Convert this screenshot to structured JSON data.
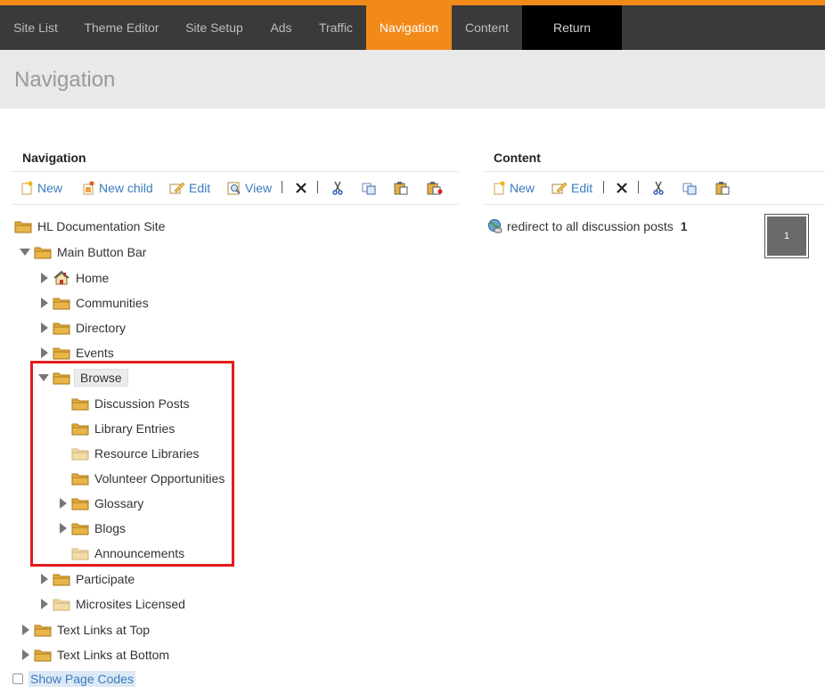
{
  "topnav": {
    "tabs": [
      {
        "label": "Site List"
      },
      {
        "label": "Theme Editor"
      },
      {
        "label": "Site Setup"
      },
      {
        "label": "Ads"
      },
      {
        "label": "Traffic"
      },
      {
        "label": "Navigation",
        "active": true
      },
      {
        "label": "Content"
      },
      {
        "label": "Return"
      }
    ],
    "accent_color": "#f28a1a"
  },
  "page": {
    "title": "Navigation"
  },
  "nav_panel": {
    "title": "Navigation",
    "toolbar": {
      "new_label": "New",
      "new_child_label": "New child",
      "edit_label": "Edit",
      "view_label": "View",
      "icons": [
        "new-icon",
        "new-child-icon",
        "edit-icon",
        "view-icon",
        "delete-icon",
        "cut-icon",
        "copy-icon",
        "paste-icon",
        "paste-child-icon"
      ]
    },
    "tree": [
      {
        "label": "HL Documentation Site",
        "icon": "folder-icon"
      },
      {
        "label": "Main Button Bar",
        "state": "expanded"
      },
      {
        "label": "Home",
        "icon": "home-icon",
        "state": "collapsed"
      },
      {
        "label": "Communities",
        "state": "collapsed"
      },
      {
        "label": "Directory",
        "state": "collapsed"
      },
      {
        "label": "Events",
        "state": "collapsed"
      },
      {
        "label": "Browse",
        "state": "expanded",
        "selected": true
      },
      {
        "label": "Discussion Posts"
      },
      {
        "label": "Library Entries"
      },
      {
        "label": "Resource Libraries",
        "faded": true
      },
      {
        "label": "Volunteer Opportunities"
      },
      {
        "label": "Glossary",
        "state": "collapsed"
      },
      {
        "label": "Blogs",
        "state": "collapsed"
      },
      {
        "label": "Announcements",
        "faded": true
      },
      {
        "label": "Participate",
        "state": "collapsed"
      },
      {
        "label": "Microsites Licensed",
        "state": "collapsed",
        "faded": true
      },
      {
        "label": "Text Links at Top",
        "state": "collapsed"
      },
      {
        "label": "Text Links at Bottom",
        "state": "collapsed"
      }
    ],
    "show_page_codes_label": "Show Page Codes"
  },
  "content_panel": {
    "title": "Content",
    "toolbar": {
      "new_label": "New",
      "edit_label": "Edit"
    },
    "items": [
      {
        "label": "redirect to all discussion posts",
        "count": "1",
        "icon": "link-globe-icon"
      }
    ],
    "page_thumbnail_label": "1"
  },
  "colors": {
    "highlight_border": "#e31b1b",
    "link": "#3a7bbf"
  }
}
